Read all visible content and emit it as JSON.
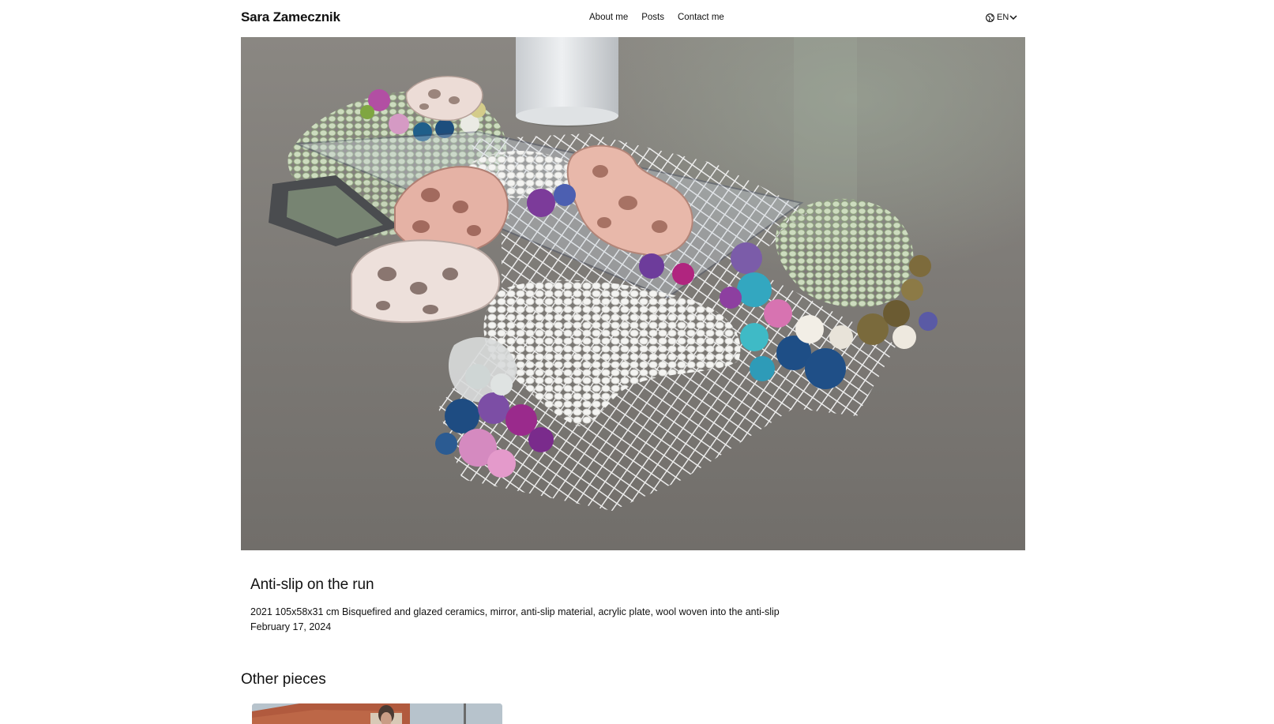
{
  "header": {
    "brand": "Sara Zamecznik",
    "nav": [
      {
        "label": "About me"
      },
      {
        "label": "Posts"
      },
      {
        "label": "Contact me"
      }
    ],
    "language": {
      "label": "EN",
      "icon": "globe-icon",
      "chevron": "chevron-down-icon"
    }
  },
  "post": {
    "title": "Anti-slip on the run",
    "description": "2021 105x58x31 cm Bisquefired and glazed ceramics, mirror, anti-slip material, acrylic plate, wool woven into the anti-slip",
    "date": "February 17, 2024"
  },
  "other": {
    "heading": "Other pieces"
  }
}
